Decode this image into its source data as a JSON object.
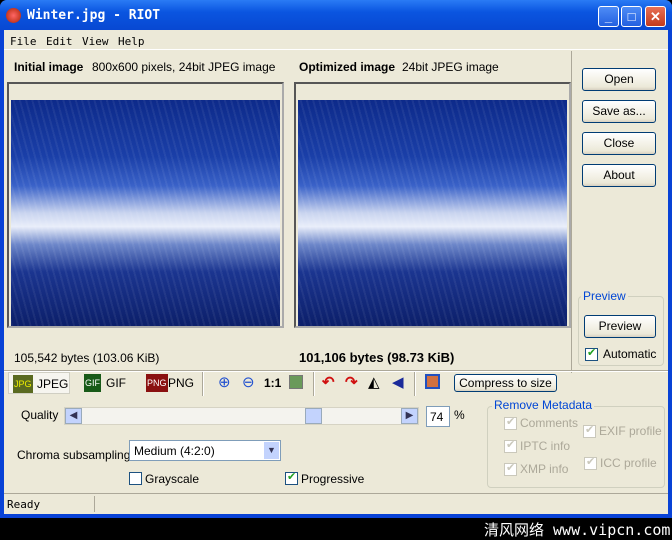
{
  "window": {
    "title": "Winter.jpg - RIOT"
  },
  "menu": [
    "File",
    "Edit",
    "View",
    "Help"
  ],
  "initial": {
    "label": "Initial image",
    "info": "800x600 pixels, 24bit JPEG image",
    "size": "105,542 bytes (103.06 KiB)"
  },
  "optimized": {
    "label": "Optimized image",
    "info": "24bit JPEG image",
    "size": "101,106 bytes (98.73 KiB)"
  },
  "side": {
    "open": "Open",
    "save": "Save as...",
    "close": "Close",
    "about": "About",
    "preview_group": "Preview",
    "preview_btn": "Preview",
    "automatic": "Automatic"
  },
  "toolbar": {
    "jpeg": "JPEG",
    "gif": "GIF",
    "png": "PNG",
    "one_to_one": "1:1",
    "compress": "Compress to size"
  },
  "settings": {
    "quality_label": "Quality",
    "quality": 74,
    "quality_value": "74",
    "percent": "%",
    "chroma_label": "Chroma subsampling",
    "chroma_value": "Medium (4:2:0)",
    "grayscale": "Grayscale",
    "progressive": "Progressive"
  },
  "metadata": {
    "title": "Remove Metadata",
    "comments": "Comments",
    "iptc": "IPTC info",
    "xmp": "XMP info",
    "exif": "EXIF profile",
    "icc": "ICC profile"
  },
  "status": "Ready",
  "watermark": "清风网络 www.vipcn.com"
}
